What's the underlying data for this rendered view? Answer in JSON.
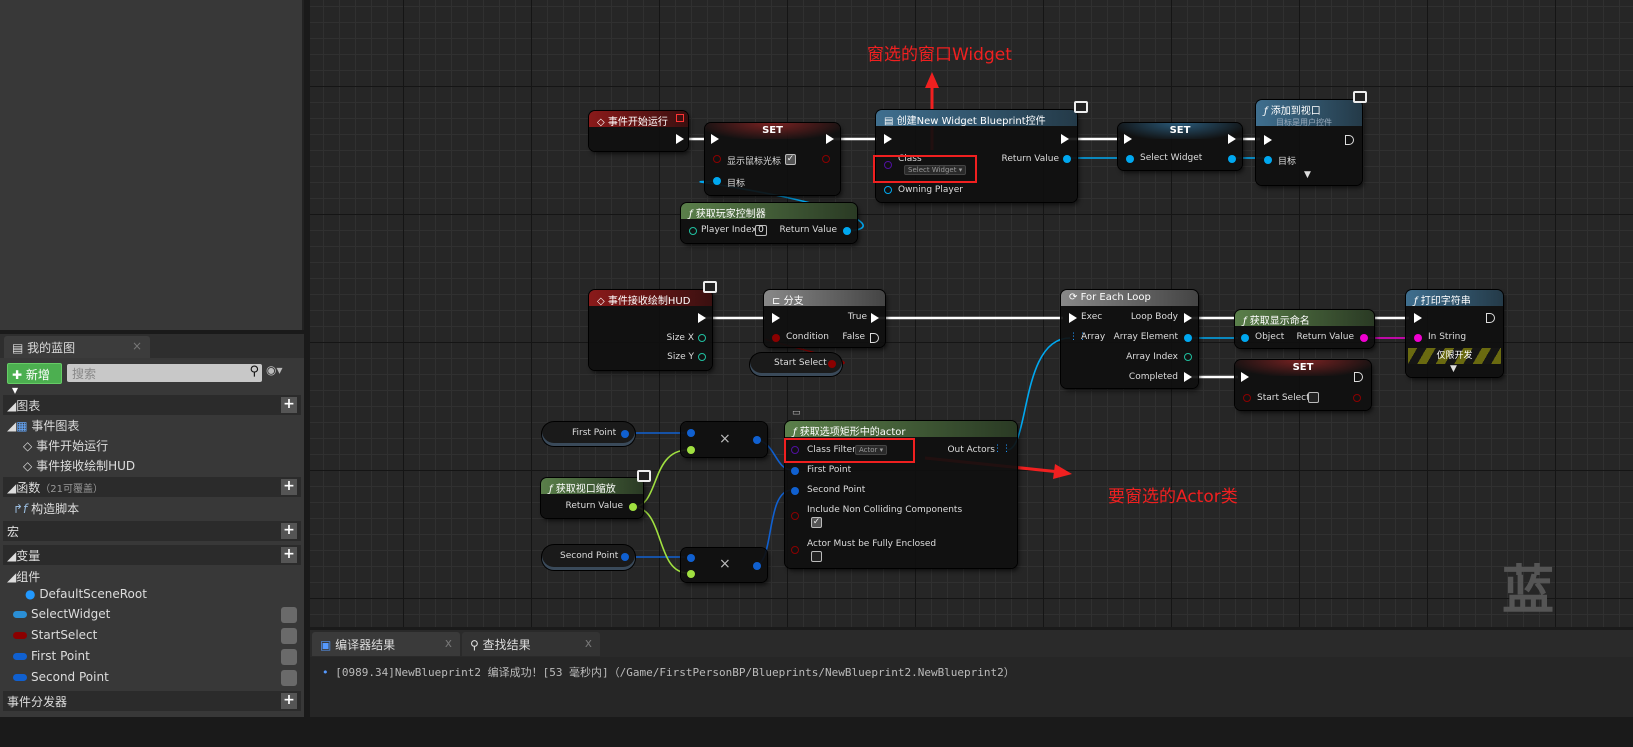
{
  "my_blueprint": {
    "tab": "我的蓝图",
    "new_label": "新增",
    "search_placeholder": "搜索",
    "sections": {
      "graphs": "图表",
      "event_graph": "事件图表",
      "event_begin": "事件开始运行",
      "event_hud": "事件接收绘制HUD",
      "functions": "函数",
      "functions_note": "（21可覆盖）",
      "construction": "构造脚本",
      "macros": "宏",
      "variables": "变量",
      "components": "组件",
      "default_root": "DefaultSceneRoot",
      "dispatchers": "事件分发器"
    },
    "variables": [
      {
        "name": "SelectWidget",
        "color": "#2a8fd6"
      },
      {
        "name": "StartSelect",
        "color": "#8b0000"
      },
      {
        "name": "First Point",
        "color": "#1060d0"
      },
      {
        "name": "Second Point",
        "color": "#1060d0"
      }
    ]
  },
  "nodes": {
    "begin_play": {
      "title": "事件开始运行"
    },
    "set1": {
      "title": "SET",
      "pin": "显示鼠标光标",
      "target": "目标"
    },
    "create_widget": {
      "title": "创建New Widget Blueprint控件",
      "class": "Class",
      "class_value": "Select Widget",
      "owning": "Owning Player",
      "ret": "Return Value"
    },
    "set2": {
      "title": "SET",
      "pin": "Select Widget"
    },
    "add_viewport": {
      "title": "添加到视口",
      "subtitle": "目标是用户控件",
      "target": "目标"
    },
    "get_pc": {
      "title": "获取玩家控制器",
      "index": "Player Index",
      "index_value": "0",
      "ret": "Return Value"
    },
    "hud": {
      "title": "事件接收绘制HUD",
      "sx": "Size X",
      "sy": "Size Y"
    },
    "branch": {
      "title": "分支",
      "cond": "Condition",
      "t": "True",
      "f": "False"
    },
    "start_select_get": {
      "label": "Start Select"
    },
    "foreach": {
      "title": "For Each Loop",
      "exec": "Exec",
      "array": "Array",
      "body": "Loop Body",
      "elem": "Array Element",
      "idx": "Array Index",
      "done": "Completed"
    },
    "display_name": {
      "title": "获取显示命名",
      "obj": "Object",
      "ret": "Return Value"
    },
    "set3": {
      "title": "SET",
      "pin": "Start Select"
    },
    "print": {
      "title": "打印字符串",
      "in": "In String",
      "dev": "仅限开发"
    },
    "first_get": {
      "label": "First Point"
    },
    "second_get": {
      "label": "Second Point"
    },
    "mul1": {
      "op": "×"
    },
    "mul2": {
      "op": "×"
    },
    "viewport_scale": {
      "title": "获取视口缩放",
      "ret": "Return Value"
    },
    "get_actors": {
      "title": "获取选项矩形中的actor",
      "filter": "Class Filter",
      "filter_value": "Actor",
      "p1": "First Point",
      "p2": "Second Point",
      "incl": "Include Non Colliding Components",
      "encl": "Actor Must be Fully Enclosed",
      "out": "Out Actors"
    }
  },
  "annotations": {
    "widget": "窗选的窗口Widget",
    "actor": "要窗选的Actor类"
  },
  "watermark": "蓝",
  "bottom": {
    "tabs": [
      "编译器结果",
      "查找结果"
    ],
    "log": "[0989.34]NewBlueprint2 编译成功！[53 毫秒内]（/Game/FirstPersonBP/Blueprints/NewBlueprint2.NewBlueprint2）"
  },
  "colors": {
    "exec": "#ffffff",
    "object": "#00a8f0",
    "bool": "#8b0000",
    "vector": "#1060d0",
    "float": "#a0e040",
    "string": "#f000d0",
    "class": "#5010a0",
    "int": "#20c0a0",
    "annotation": "#f02020"
  }
}
